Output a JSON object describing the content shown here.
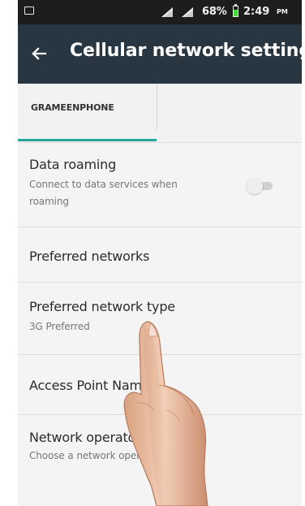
{
  "status_bar": {
    "battery_percent": "68%",
    "time": "2:49",
    "time_period": "PM",
    "battery_level": 0.68,
    "icons": {
      "left": "screenshot-icon",
      "signal_1": "signal-icon",
      "signal_2": "signal-icon",
      "battery": "battery-icon"
    }
  },
  "app_bar": {
    "back_icon": "arrow-left-icon",
    "title": "Cellular network settings"
  },
  "tabs": [
    {
      "label": "GRAMEENPHONE",
      "selected": true
    }
  ],
  "settings": {
    "data_roaming": {
      "title": "Data roaming",
      "description_line_1": "Connect to data services when",
      "description_line_2": "roaming",
      "enabled": false
    },
    "preferred_networks": {
      "title": "Preferred networks"
    },
    "preferred_network_type": {
      "title": "Preferred network type",
      "value": "3G Preferred"
    },
    "access_point_names": {
      "title": "Access Point Names"
    },
    "network_operators": {
      "title": "Network operators",
      "description": "Choose a network operator"
    }
  },
  "overlay": {
    "touch_hand": "pointing-hand"
  },
  "colors": {
    "status_bar": "#1d1d1d",
    "app_bar": "#283641",
    "tab_indicator": "#27a59a",
    "battery_fill": "#49d63c"
  }
}
